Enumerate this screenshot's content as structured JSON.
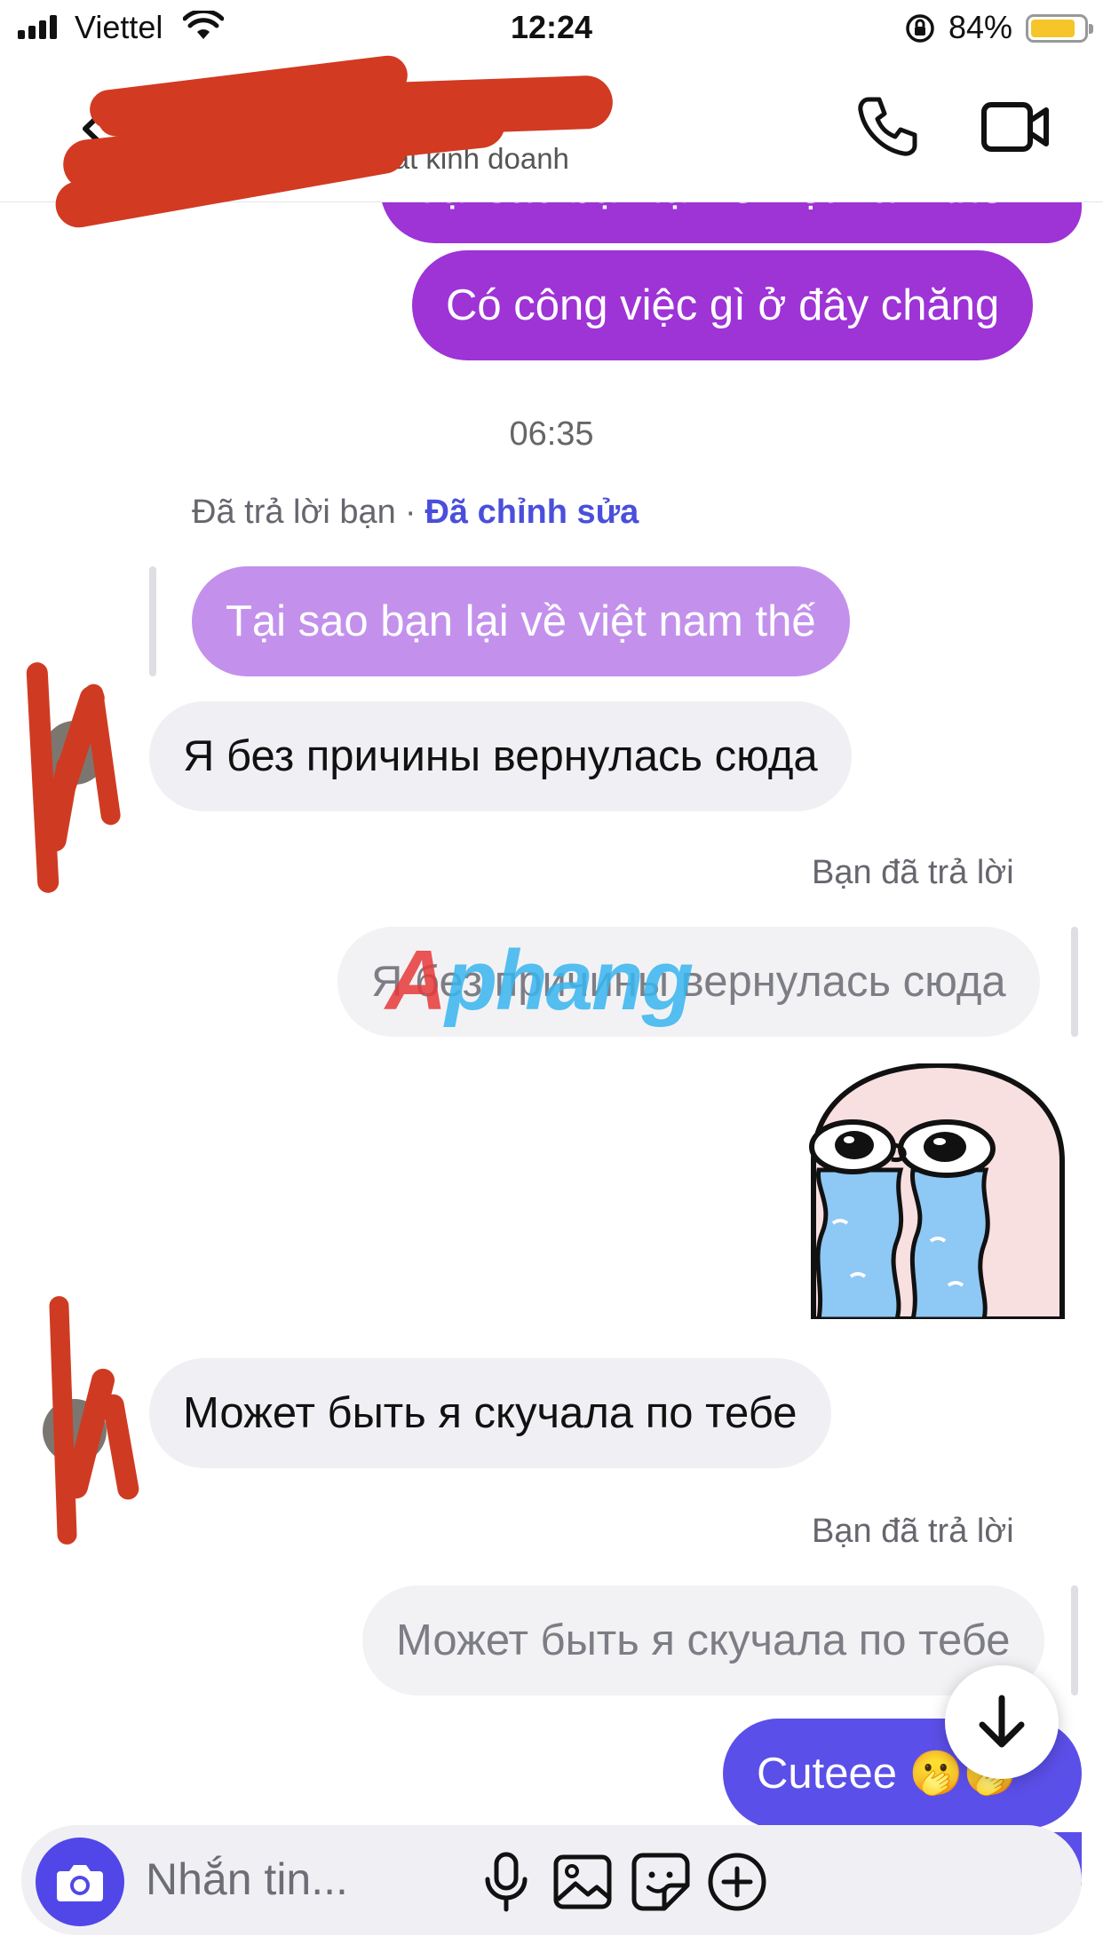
{
  "status_bar": {
    "carrier": "Viettel",
    "time": "12:24",
    "battery": "84%",
    "battery_level": 0.84
  },
  "header": {
    "subtitle": "Bạn chat kinh doanh"
  },
  "messages": {
    "top_partial": "Tại sao bạn lại về việt nam thế",
    "out_1": "Có công việc gì ở đây chăng",
    "timestamp": "06:35",
    "reply_meta": {
      "replied": "Đã trả lời bạn",
      "dot": "·",
      "edited": "Đã chỉnh sửa"
    },
    "quoted_1": "Tại sao bạn lại về việt nam thế",
    "in_1": "Я без причины вернулась сюда",
    "you_replied_1": "Bạn đã trả lời",
    "quoted_2": "Я без причины вернулась сюда",
    "in_2": "Может быть я скучала по тебе",
    "you_replied_2": "Bạn đã trả lời",
    "quoted_3": "Может быть я скучала по тебе",
    "out_last": "Cuteee 🫢🫢"
  },
  "watermark": {
    "part1": "A",
    "part2": "phang"
  },
  "composer": {
    "placeholder": "Nhắn tin..."
  },
  "colors": {
    "outgoing_purple": "#9e33d6",
    "outgoing_blue": "#5b4fe9",
    "incoming_grey": "#f0f0f4",
    "accent": "#5147e8",
    "redaction": "#d23a22"
  },
  "icons": [
    "signal-icon",
    "wifi-icon",
    "orientation-lock-icon",
    "battery-icon",
    "back-icon",
    "phone-icon",
    "video-icon",
    "camera-icon",
    "microphone-icon",
    "image-icon",
    "sticker-icon",
    "plus-icon",
    "arrow-down-icon"
  ]
}
